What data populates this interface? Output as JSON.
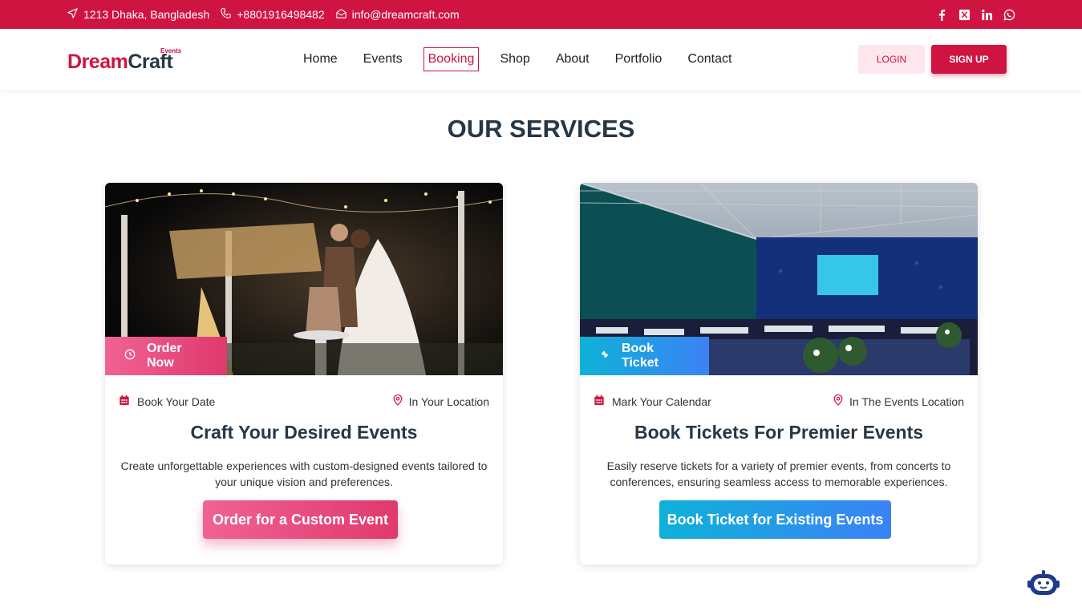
{
  "topbar": {
    "address": "1213 Dhaka, Bangladesh",
    "phone": "+8801916498482",
    "email": "info@dreamcraft.com",
    "social": [
      "facebook-icon",
      "x-icon",
      "linkedin-icon",
      "whatsapp-icon"
    ]
  },
  "logo": {
    "main_d": "D",
    "main_ream": "ream",
    "main_craft": "Craft",
    "sub": "Events"
  },
  "nav": {
    "items": [
      {
        "label": "Home"
      },
      {
        "label": "Events"
      },
      {
        "label": "Booking",
        "active": true
      },
      {
        "label": "Shop"
      },
      {
        "label": "About"
      },
      {
        "label": "Portfolio"
      },
      {
        "label": "Contact"
      }
    ]
  },
  "auth": {
    "login_label": "LOGIN",
    "signup_label": "SIGN UP"
  },
  "section": {
    "title": "OUR SERVICES"
  },
  "cards": [
    {
      "badge": "Order Now",
      "badge_icon": "clock-icon",
      "meta_left": "Book Your Date",
      "meta_right": "In Your Location",
      "title": "Craft Your Desired Events",
      "description": "Create unforgettable experiences with custom-designed events tailored to your unique vision and preferences.",
      "cta": "Order for a Custom Event"
    },
    {
      "badge": "Book Ticket",
      "badge_icon": "ticket-icon",
      "meta_left": "Mark Your Calendar",
      "meta_right": "In The Events Location",
      "title": "Book Tickets For Premier Events",
      "description": "Easily reserve tickets for a variety of premier events, from concerts to conferences, ensuring seamless access to memorable experiences.",
      "cta": "Book Ticket for Existing Events"
    }
  ],
  "colors": {
    "brand": "#cf1442",
    "dark": "#263746",
    "pink": "#e0396e",
    "blue": "#3b82f6",
    "cyan": "#0eb2d8"
  }
}
